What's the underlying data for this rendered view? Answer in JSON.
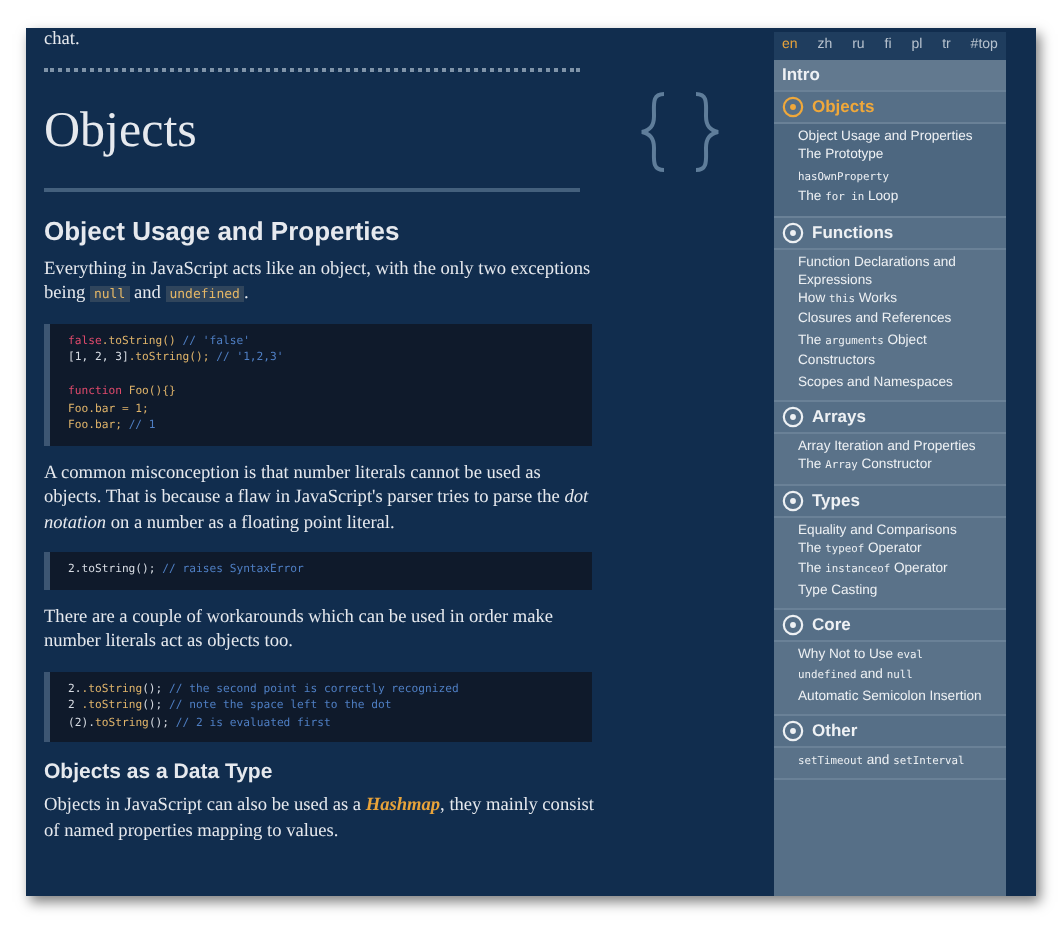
{
  "intro_text": "chat.",
  "page_title": "Objects",
  "content": [
    {
      "kind": "h2",
      "text": "Object Usage and Properties"
    },
    {
      "kind": "p",
      "segments": [
        {
          "kind": "text",
          "text": "Everything in JavaScript acts like an object, with the only two exceptions being "
        },
        {
          "kind": "code",
          "text": "null"
        },
        {
          "kind": "text",
          "text": " and "
        },
        {
          "kind": "code",
          "text": "undefined"
        },
        {
          "kind": "text",
          "text": "."
        }
      ]
    },
    {
      "kind": "code",
      "lines": [
        [
          {
            "kind": "keyword",
            "text": "false"
          },
          {
            "kind": "func",
            "text": ".toString() "
          },
          {
            "kind": "comment",
            "text": "// 'false'"
          }
        ],
        [
          {
            "kind": "plain",
            "text": "[1, 2, 3]"
          },
          {
            "kind": "func",
            "text": ".toString(); "
          },
          {
            "kind": "comment",
            "text": "// '1,2,3'"
          }
        ],
        {
          "kind": "blank"
        },
        [
          {
            "kind": "keyword",
            "text": "function"
          },
          {
            "kind": "func",
            "text": " Foo(){}"
          }
        ],
        [
          {
            "kind": "func",
            "text": "Foo.bar = 1;"
          }
        ],
        [
          {
            "kind": "func",
            "text": "Foo.bar; "
          },
          {
            "kind": "comment",
            "text": "// 1"
          }
        ]
      ]
    },
    {
      "kind": "p",
      "segments": [
        {
          "kind": "text",
          "text": "A common misconception is that number literals cannot be used as objects. That is because a flaw in JavaScript's parser tries to parse the *dot notation* on a number as a floating point literal."
        }
      ]
    },
    {
      "kind": "code",
      "lines": [
        [
          {
            "kind": "plain",
            "text": "2.toString(); "
          },
          {
            "kind": "comment",
            "text": "// raises SyntaxError"
          }
        ]
      ]
    },
    {
      "kind": "p",
      "segments": [
        {
          "kind": "text",
          "text": "There are a couple of workarounds which can be used in order make number literals act as objects too."
        }
      ]
    },
    {
      "kind": "code",
      "lines": [
        [
          {
            "kind": "plain",
            "text": "2."
          },
          {
            "kind": "func",
            "text": ".toString"
          },
          {
            "kind": "plain",
            "text": "(); "
          },
          {
            "kind": "comment",
            "text": "// the second point is correctly recognized"
          }
        ],
        [
          {
            "kind": "plain",
            "text": "2 "
          },
          {
            "kind": "func",
            "text": ".toString"
          },
          {
            "kind": "plain",
            "text": "(); "
          },
          {
            "kind": "comment",
            "text": "// note the space left to the dot"
          }
        ],
        [
          {
            "kind": "plain",
            "text": "(2)."
          },
          {
            "kind": "func",
            "text": "toString"
          },
          {
            "kind": "plain",
            "text": "(); "
          },
          {
            "kind": "comment",
            "text": "// 2 is evaluated first"
          }
        ]
      ]
    },
    {
      "kind": "h3",
      "text": "Objects as a Data Type"
    },
    {
      "kind": "p",
      "segments": [
        {
          "kind": "text",
          "text": "Objects in JavaScript can also be used as a "
        },
        {
          "kind": "link",
          "text": "Hashmap"
        },
        {
          "kind": "text",
          "text": ", they mainly consist of named properties mapping to values."
        }
      ]
    }
  ],
  "languages": [
    {
      "label": "en",
      "selected": true
    },
    {
      "label": "zh",
      "selected": false
    },
    {
      "label": "ru",
      "selected": false
    },
    {
      "label": "fi",
      "selected": false
    },
    {
      "label": "pl",
      "selected": false
    },
    {
      "label": "tr",
      "selected": false
    },
    {
      "label": "#top",
      "selected": false
    }
  ],
  "sections": [
    {
      "kind": "intro",
      "title": "Intro",
      "selected": false
    },
    {
      "kind": "section",
      "title": "Objects",
      "selected": true,
      "items": [
        [
          {
            "kind": "text",
            "text": "Object Usage and Properties"
          }
        ],
        [
          {
            "kind": "text",
            "text": "The Prototype"
          }
        ],
        [
          {
            "kind": "code",
            "text": "hasOwnProperty"
          }
        ],
        [
          {
            "kind": "text",
            "text": "The "
          },
          {
            "kind": "code",
            "text": "for in"
          },
          {
            "kind": "text",
            "text": " Loop"
          }
        ]
      ]
    },
    {
      "kind": "section",
      "title": "Functions",
      "selected": false,
      "items": [
        [
          {
            "kind": "text",
            "text": "Function Declarations and Expressions"
          }
        ],
        [
          {
            "kind": "text",
            "text": "How "
          },
          {
            "kind": "code",
            "text": "this"
          },
          {
            "kind": "text",
            "text": " Works"
          }
        ],
        [
          {
            "kind": "text",
            "text": "Closures and References"
          }
        ],
        [
          {
            "kind": "text",
            "text": "The "
          },
          {
            "kind": "code",
            "text": "arguments"
          },
          {
            "kind": "text",
            "text": " Object"
          }
        ],
        [
          {
            "kind": "text",
            "text": "Constructors"
          }
        ],
        [
          {
            "kind": "text",
            "text": "Scopes and Namespaces"
          }
        ]
      ]
    },
    {
      "kind": "section",
      "title": "Arrays",
      "selected": false,
      "items": [
        [
          {
            "kind": "text",
            "text": "Array Iteration and Properties"
          }
        ],
        [
          {
            "kind": "text",
            "text": "The "
          },
          {
            "kind": "code",
            "text": "Array"
          },
          {
            "kind": "text",
            "text": " Constructor"
          }
        ]
      ]
    },
    {
      "kind": "section",
      "title": "Types",
      "selected": false,
      "items": [
        [
          {
            "kind": "text",
            "text": "Equality and Comparisons"
          }
        ],
        [
          {
            "kind": "text",
            "text": "The "
          },
          {
            "kind": "code",
            "text": "typeof"
          },
          {
            "kind": "text",
            "text": " Operator"
          }
        ],
        [
          {
            "kind": "text",
            "text": "The "
          },
          {
            "kind": "code",
            "text": "instanceof"
          },
          {
            "kind": "text",
            "text": " Operator"
          }
        ],
        [
          {
            "kind": "text",
            "text": "Type Casting"
          }
        ]
      ]
    },
    {
      "kind": "section",
      "title": "Core",
      "selected": false,
      "items": [
        [
          {
            "kind": "text",
            "text": "Why Not to Use "
          },
          {
            "kind": "code",
            "text": "eval"
          }
        ],
        [
          {
            "kind": "code",
            "text": "undefined"
          },
          {
            "kind": "text",
            "text": " and "
          },
          {
            "kind": "code",
            "text": "null"
          }
        ],
        [
          {
            "kind": "text",
            "text": "Automatic Semicolon Insertion"
          }
        ]
      ]
    },
    {
      "kind": "section",
      "title": "Other",
      "selected": false,
      "items": [
        [
          {
            "kind": "code",
            "text": "setTimeout"
          },
          {
            "kind": "text",
            "text": " and "
          },
          {
            "kind": "code",
            "text": "setInterval"
          }
        ]
      ]
    }
  ]
}
